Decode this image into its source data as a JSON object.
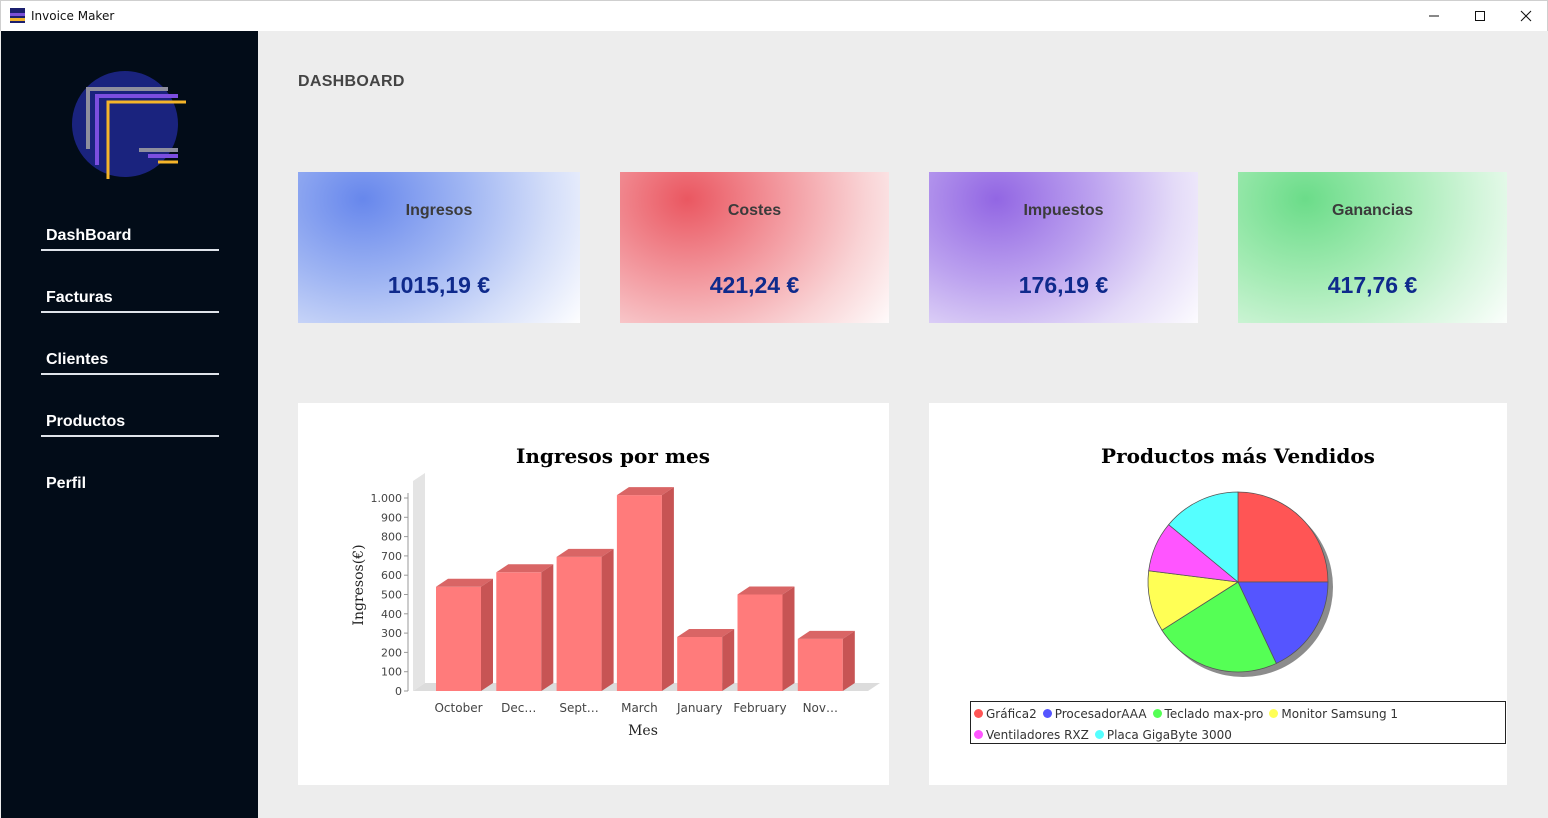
{
  "window": {
    "title": "Invoice Maker",
    "minimize": "—",
    "maximize": "☐",
    "close": "✕"
  },
  "sidebar": {
    "items": [
      {
        "label": "DashBoard"
      },
      {
        "label": "Facturas"
      },
      {
        "label": "Clientes"
      },
      {
        "label": "Productos"
      },
      {
        "label": "Perfil"
      }
    ]
  },
  "main": {
    "title": "DASHBOARD"
  },
  "cards": {
    "ingresos": {
      "label": "Ingresos",
      "value": "1015,19 €",
      "color": "#6787ec"
    },
    "costes": {
      "label": "Costes",
      "value": "421,24 €",
      "color": "#ea5761"
    },
    "impuestos": {
      "label": "Impuestos",
      "value": "176,19 €",
      "color": "#9266e3"
    },
    "ganancias": {
      "label": "Ganancias",
      "value": "417,76 €",
      "color": "#6bdc89"
    }
  },
  "chart_data": [
    {
      "type": "bar",
      "title": "Ingresos por mes",
      "xlabel": "Mes",
      "ylabel": "Ingresos(€)",
      "categories": [
        "October",
        "Dec…",
        "Sept…",
        "March",
        "January",
        "February",
        "Nov…"
      ],
      "values": [
        540,
        615,
        695,
        1015,
        280,
        500,
        270
      ],
      "ylim": [
        0,
        1000
      ],
      "yticks": [
        "0",
        "100",
        "200",
        "300",
        "400",
        "500",
        "600",
        "700",
        "800",
        "900",
        "1.000"
      ],
      "bar_color": "#ff7b7b",
      "grid": false,
      "three_d": true
    },
    {
      "type": "pie",
      "title": "Productos más Vendidos",
      "labels": [
        "Gráfica2",
        "ProcesadorAAA",
        "Teclado max-pro",
        "Monitor Samsung 1",
        "Ventiladores RXZ",
        "Placa GigaByte 3000"
      ],
      "values": [
        25,
        18,
        23,
        11,
        9,
        14
      ],
      "colors": [
        "#ff5555",
        "#5555ff",
        "#55ff55",
        "#ffff55",
        "#ff55ff",
        "#55ffff"
      ],
      "legend_position": "bottom"
    }
  ]
}
